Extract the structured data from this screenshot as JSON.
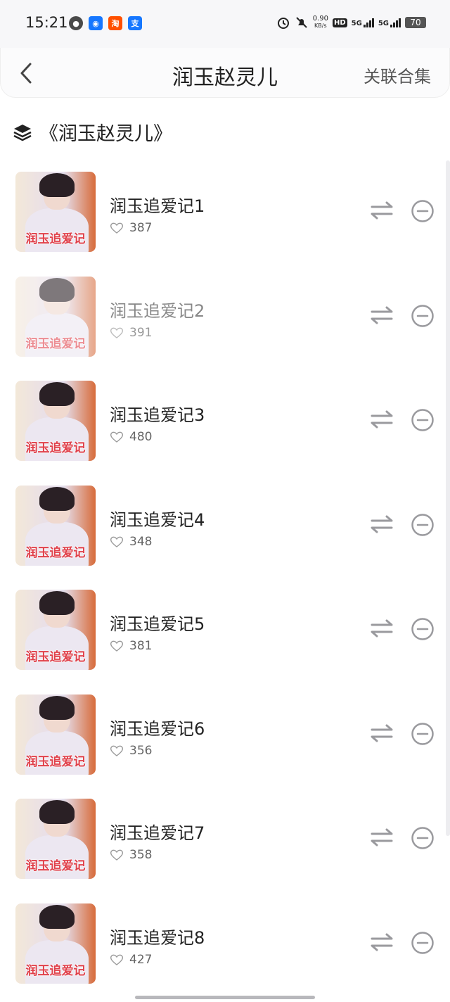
{
  "status": {
    "time": "15:21",
    "net_speed_top": "0.90",
    "net_speed_unit": "KB/s",
    "hd": "HD",
    "sim1": "5G",
    "sim2": "5G",
    "battery": "70"
  },
  "header": {
    "title": "润玉赵灵儿",
    "action_label": "关联合集"
  },
  "collection": {
    "name": "《润玉赵灵儿》"
  },
  "items": [
    {
      "title": "润玉追爱记1",
      "likes": "387",
      "caption": "润玉追爱记"
    },
    {
      "title": "润玉追爱记2",
      "likes": "391",
      "caption": "润玉追爱记"
    },
    {
      "title": "润玉追爱记3",
      "likes": "480",
      "caption": "润玉追爱记"
    },
    {
      "title": "润玉追爱记4",
      "likes": "348",
      "caption": "润玉追爱记"
    },
    {
      "title": "润玉追爱记5",
      "likes": "381",
      "caption": "润玉追爱记"
    },
    {
      "title": "润玉追爱记6",
      "likes": "356",
      "caption": "润玉追爱记"
    },
    {
      "title": "润玉追爱记7",
      "likes": "358",
      "caption": "润玉追爱记"
    },
    {
      "title": "润玉追爱记8",
      "likes": "427",
      "caption": "润玉追爱记"
    }
  ],
  "icons": {
    "back": "chevron-left-icon",
    "collection": "layers-icon",
    "like": "heart-outline-icon",
    "swap": "swap-arrows-icon",
    "remove": "minus-circle-icon"
  },
  "colors": {
    "caption_red": "#e0404a",
    "icon_gray": "#9a9a9e"
  }
}
